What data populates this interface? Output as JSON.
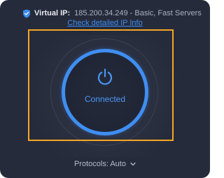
{
  "header": {
    "ip_label": "Virtual IP:",
    "ip_value": "185.200.34.249 - Basic, Fast Servers",
    "detail_link": "Check detailed IP Info",
    "shield_icon": "shield-check-icon"
  },
  "connection": {
    "status": "Connected",
    "power_icon": "power-icon",
    "accent_color": "#3f8ef2"
  },
  "footer": {
    "protocols_label": "Protocols: Auto",
    "chevron_icon": "chevron-down-icon"
  },
  "colors": {
    "background": "#262b3b",
    "highlight": "#f5a623",
    "link": "#3d8df0"
  }
}
